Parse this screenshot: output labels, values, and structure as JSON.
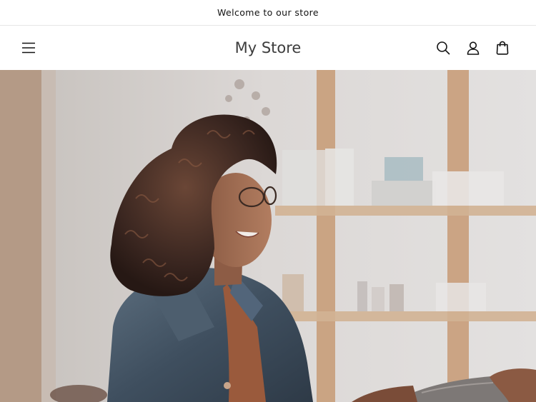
{
  "announcement": {
    "text": "Welcome to our store"
  },
  "header": {
    "store_name": "My Store",
    "icons": {
      "menu": "hamburger-menu-icon",
      "search": "search-icon",
      "account": "user-account-icon",
      "cart": "shopping-bag-icon"
    }
  },
  "hero": {
    "image": "smiling-woman-in-denim-jacket-receiving-package-in-shop"
  }
}
